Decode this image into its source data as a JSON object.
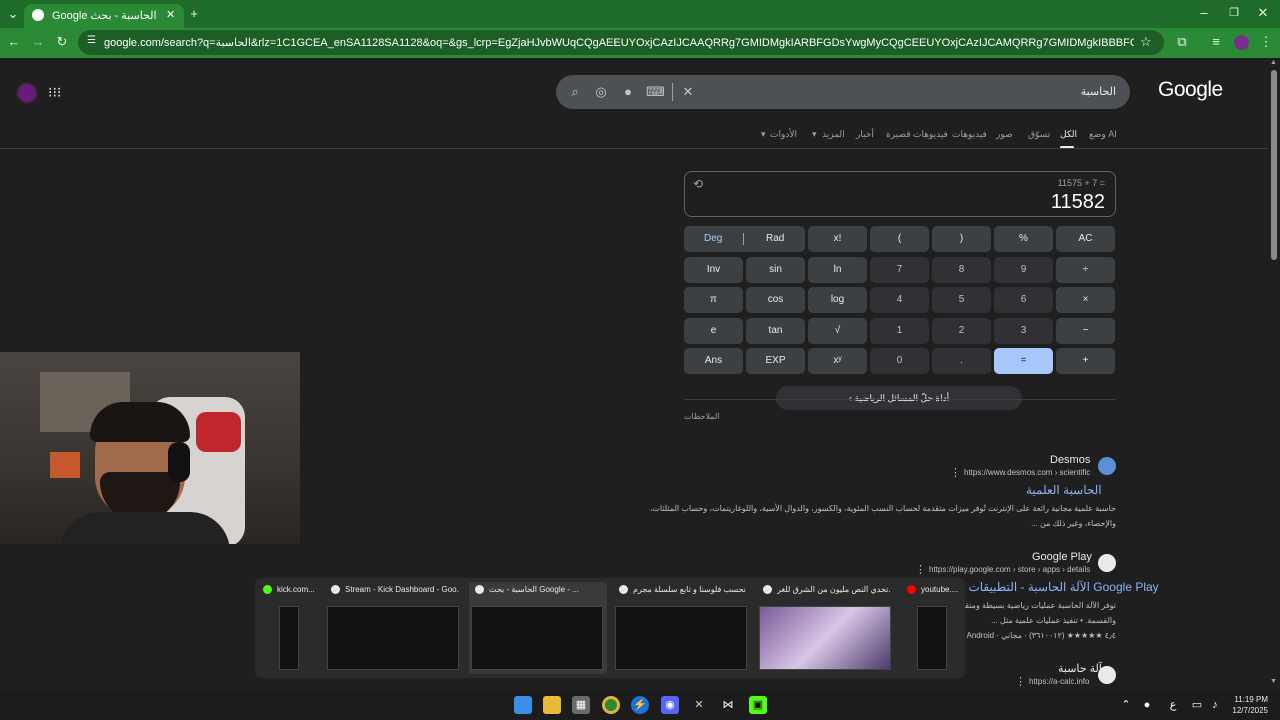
{
  "browser": {
    "tab_title": "الحاسبة - بحث Google",
    "url": "google.com/search?q=الحاسبة&rlz=1C1GCEA_enSA1128SA1128&oq=&gs_lcrp=EgZjaHJvbWUqCQgAEEUYOxjCAzIJCAAQRRg7GMIDMgkIARBFGDsYwgMyCQgCEEUYOxjCAzIJCAMQRRg7GMIDMgkIBBBFGDsYwgMyCQgFEEUYOxjCAzIJCAYQRRg7GMIDM...",
    "new_tab_label": "+"
  },
  "search": {
    "query": "الحاسبة",
    "logo": "Google",
    "tabs": [
      "وضع AI",
      "الكل",
      "تسوّق",
      "صور",
      "فيديوهات",
      "فيديوهات قصيرة",
      "أخبار",
      "المزيد",
      "الأدوات"
    ]
  },
  "calculator": {
    "expression": "11575 + 7 =",
    "result": "11582",
    "deg": "Deg",
    "rad": "Rad",
    "rows": [
      [
        "x!",
        "(",
        ")",
        "%",
        "AC"
      ],
      [
        "Inv",
        "sin",
        "ln",
        "7",
        "8",
        "9",
        "÷"
      ],
      [
        "π",
        "cos",
        "log",
        "4",
        "5",
        "6",
        "×"
      ],
      [
        "e",
        "tan",
        "√",
        "1",
        "2",
        "3",
        "−"
      ],
      [
        "Ans",
        "EXP",
        "xʸ",
        "0",
        ".",
        "=",
        "+"
      ]
    ],
    "math_tool": "أداة حلّ المسائل الرياضية",
    "feedback": "الملاحظات"
  },
  "results": [
    {
      "site": "Desmos",
      "url": "https://www.desmos.com › scientific",
      "title": "الحاسبة العلمية",
      "snippet1": "حاسبة علمية مجانية رائعة على الإنترنت تُوفر ميزات متقدمة لحساب النسب المئوية، والكسور، والدوال الأسية، واللوغاريتمات، وحساب المثلثات،",
      "snippet2": "والإحصاء، وغير ذلك من ..."
    },
    {
      "site": "Google Play",
      "url": "https://play.google.com › store › apps › details",
      "title": "الآلة الحاسبة - التطبيقات على Google Play",
      "snippet1": "توفر الآلة الحاسبة عمليات رياضية بسيطة ومتقدمة",
      "snippet2": "والقسمة. • تنفيذ عمليات علمية مثل ...",
      "rating": "٤٫٤ ★★★★★ (٣٦١٠٠١٢) · مجاني · Android"
    },
    {
      "site": "آلة حاسبة",
      "url": "https://a-calc.info"
    }
  ],
  "thumbnails": [
    {
      "title": "kick.com...",
      "color": "#53fc18"
    },
    {
      "title": "Stream - Kick Dashboard - Goo...",
      "color": "#e8eaed"
    },
    {
      "title": "الحاسبة - بحث Google - ...",
      "color": "#e8eaed"
    },
    {
      "title": "نحسب فلوسنا و تابع سلسلة مجرم",
      "color": "#e8eaed"
    },
    {
      "title": "تحدي النص مليون من الشرق للغر...",
      "color": "#e8eaed"
    },
    {
      "title": "youtube....",
      "color": "#ff0000"
    }
  ],
  "taskbar": {
    "time": "11:19 PM",
    "date": "12/7/2025",
    "lang": "ع"
  }
}
